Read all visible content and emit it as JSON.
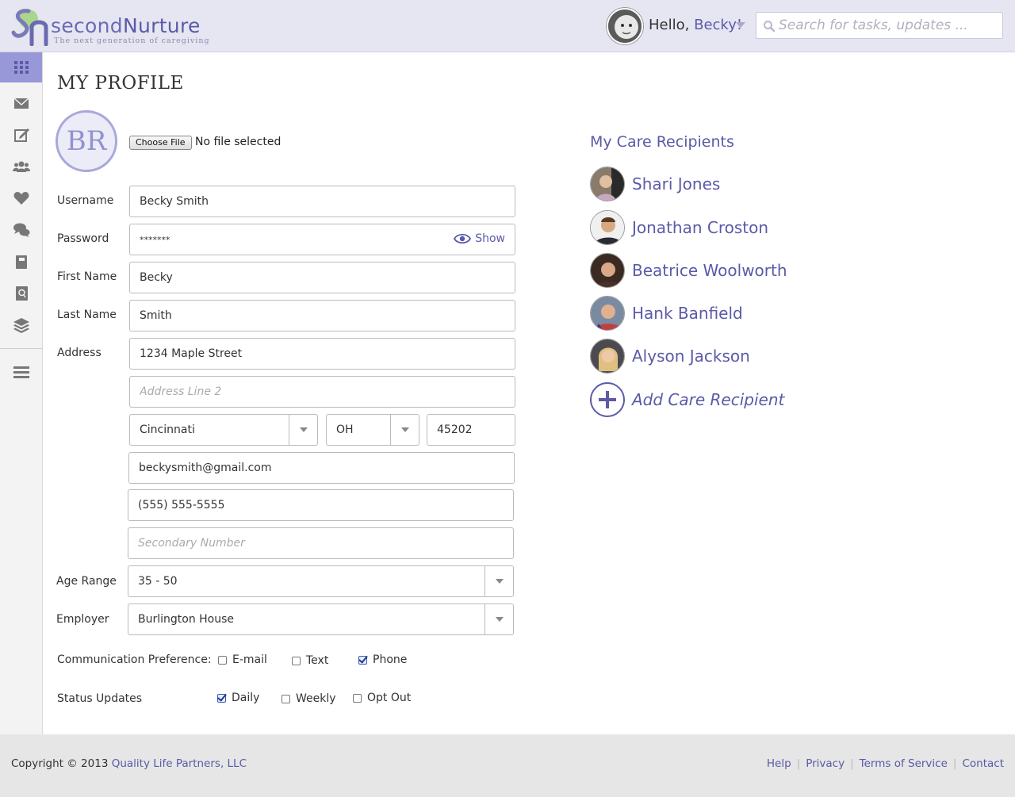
{
  "app": {
    "logo_name_a": "second",
    "logo_name_b": "Nurture",
    "tagline": "The next generation of caregiving",
    "brand_color": "#5a5aa8"
  },
  "header": {
    "greeting": "Hello,",
    "user_name": "Becky!",
    "search_placeholder": "Search for tasks, updates ..."
  },
  "sidebar": {
    "items": [
      {
        "icon": "grid-icon",
        "active": true
      },
      {
        "icon": "mail-icon"
      },
      {
        "icon": "edit-icon"
      },
      {
        "icon": "group-icon"
      },
      {
        "icon": "heart-icon"
      },
      {
        "icon": "chat-icon"
      },
      {
        "icon": "book-icon"
      },
      {
        "icon": "contacts-icon"
      },
      {
        "icon": "layers-icon"
      },
      {
        "icon": "menu-icon"
      }
    ]
  },
  "profile": {
    "title": "MY PROFILE",
    "initials": "BR",
    "choose_file": "Choose File",
    "no_file": "No file selected",
    "labels": {
      "username": "Username",
      "password": "Password",
      "first_name": "First Name",
      "last_name": "Last Name",
      "address": "Address",
      "age_range": "Age Range",
      "employer": "Employer",
      "comm_pref": "Communication Preference:",
      "status_updates": "Status Updates"
    },
    "username": "Becky Smith",
    "password": "*******",
    "show_label": "Show",
    "first_name": "Becky",
    "last_name": "Smith",
    "address1": "1234 Maple Street",
    "address2_placeholder": "Address Line 2",
    "city": "Cincinnati",
    "state": "OH",
    "zip": "45202",
    "email": "beckysmith@gmail.com",
    "phone": "(555) 555-5555",
    "phone2_placeholder": "Secondary Number",
    "age_range": "35 - 50",
    "employer": "Burlington House",
    "comm_options": [
      {
        "label": "E-mail",
        "checked": false
      },
      {
        "label": "Text",
        "checked": false
      },
      {
        "label": "Phone",
        "checked": true
      }
    ],
    "status_options": [
      {
        "label": "Daily",
        "checked": true
      },
      {
        "label": "Weekly",
        "checked": false
      },
      {
        "label": "Opt Out",
        "checked": false
      }
    ]
  },
  "care_recipients": {
    "title": "My Care Recipients",
    "people": [
      {
        "name": "Shari Jones"
      },
      {
        "name": "Jonathan Croston"
      },
      {
        "name": "Beatrice Woolworth"
      },
      {
        "name": "Hank Banfield"
      },
      {
        "name": "Alyson Jackson"
      }
    ],
    "add_label": "Add Care Recipient"
  },
  "footer": {
    "copyright": "Copyright © 2013",
    "company": "Quality Life Partners, LLC",
    "links": [
      "Help",
      "Privacy",
      "Terms of Service",
      "Contact"
    ]
  }
}
